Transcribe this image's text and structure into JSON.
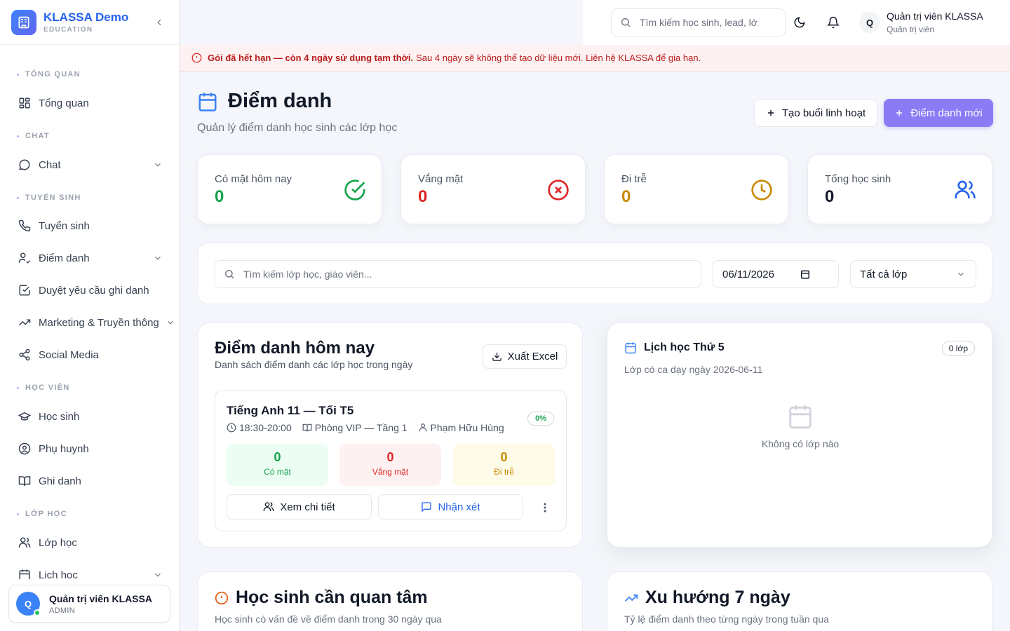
{
  "brand": {
    "name": "KLASSA Demo",
    "subtitle": "EDUCATION"
  },
  "sidebar": {
    "sections": [
      {
        "label": "TỔNG QUAN"
      },
      {
        "label": "CHAT"
      },
      {
        "label": "TUYỂN SINH"
      },
      {
        "label": "HỌC VIÊN"
      },
      {
        "label": "LỚP HỌC"
      }
    ],
    "items": [
      {
        "label": "Tổng quan",
        "icon": "grid-icon"
      },
      {
        "label": "Chat",
        "icon": "chat-icon",
        "expandable": true
      },
      {
        "label": "Tuyển sinh",
        "icon": "phone-icon"
      },
      {
        "label": "Điểm danh",
        "icon": "user-check-icon",
        "expandable": true
      },
      {
        "label": "Duyệt yêu cầu ghi danh",
        "icon": "checkbox-icon"
      },
      {
        "label": "Marketing & Truyền thông",
        "icon": "trend-icon",
        "expandable": true
      },
      {
        "label": "Social Media",
        "icon": "share-icon"
      },
      {
        "label": "Học sinh",
        "icon": "graduation-cap-icon"
      },
      {
        "label": "Phụ huynh",
        "icon": "user-circle-icon"
      },
      {
        "label": "Ghi danh",
        "icon": "book-open-icon"
      },
      {
        "label": "Lớp học",
        "icon": "users-icon"
      },
      {
        "label": "Lịch học",
        "icon": "calendar-icon",
        "expandable": true
      }
    ],
    "user": {
      "initial": "Q",
      "name": "Quản trị viên KLASSA",
      "role": "ADMIN"
    }
  },
  "topbar": {
    "search_placeholder": "Tìm kiếm học sinh, lead, lớ",
    "user": {
      "initial": "Q",
      "name": "Quản trị viên KLASSA",
      "role": "Quản trị viên"
    }
  },
  "alert": {
    "bold": "Gói đã hết hạn — còn 4 ngày sử dụng tạm thời.",
    "text": "Sau 4 ngày sẽ không thể tạo dữ liệu mới. Liên hệ KLASSA để gia hạn."
  },
  "page": {
    "title": "Điểm danh",
    "subtitle": "Quản lý điểm danh học sinh các lớp học",
    "btn_flexible": "Tạo buổi linh hoạt",
    "btn_new": "Điểm danh mới"
  },
  "stats": [
    {
      "label": "Có mặt hôm nay",
      "value": "0",
      "color": "#16a34a"
    },
    {
      "label": "Vắng mặt",
      "value": "0",
      "color": "#dc2626"
    },
    {
      "label": "Đi trễ",
      "value": "0",
      "color": "#ca8a04"
    },
    {
      "label": "Tổng học sinh",
      "value": "0",
      "color": "#111827"
    }
  ],
  "filters": {
    "search_placeholder": "Tìm kiếm lớp học, giáo viên...",
    "date": "06/11/2026",
    "class_select": "Tất cả lớp"
  },
  "today": {
    "title": "Điểm danh hôm nay",
    "subtitle": "Danh sách điểm danh các lớp học trong ngày",
    "export": "Xuất Excel",
    "class": {
      "name": "Tiếng Anh 11 — Tối T5",
      "time": "18:30-20:00",
      "room": "Phòng VIP — Tầng 1",
      "teacher": "Phạm Hữu Hùng",
      "percent": "0%",
      "present": {
        "value": "0",
        "label": "Có mặt"
      },
      "absent": {
        "value": "0",
        "label": "Vắng mặt"
      },
      "late": {
        "value": "0",
        "label": "Đi trễ"
      },
      "btn_detail": "Xem chi tiết",
      "btn_comment": "Nhận xét"
    }
  },
  "schedule": {
    "title": "Lịch học Thứ 5",
    "badge": "0 lớp",
    "subtitle": "Lớp có ca dạy ngày 2026-06-11",
    "empty": "Không có lớp nào"
  },
  "attention": {
    "title": "Học sinh cần quan tâm",
    "subtitle": "Học sinh có vấn đề về điểm danh trong 30 ngày qua"
  },
  "trend": {
    "title": "Xu hướng 7 ngày",
    "subtitle": "Tỷ lệ điểm danh theo từng ngày trong tuần qua"
  }
}
